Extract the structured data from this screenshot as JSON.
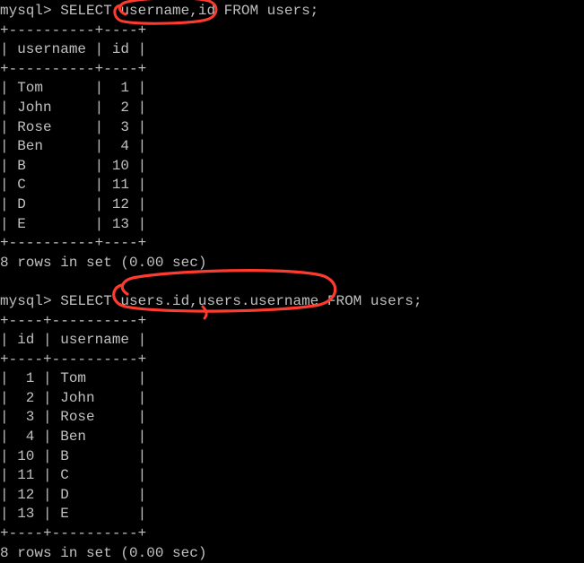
{
  "query1": {
    "prompt": "mysql> ",
    "sql": "SELECT username,id FROM users;",
    "columns": [
      "username",
      "id"
    ],
    "rows": [
      {
        "username": "Tom",
        "id": "1"
      },
      {
        "username": "John",
        "id": "2"
      },
      {
        "username": "Rose",
        "id": "3"
      },
      {
        "username": "Ben",
        "id": "4"
      },
      {
        "username": "B",
        "id": "10"
      },
      {
        "username": "C",
        "id": "11"
      },
      {
        "username": "D",
        "id": "12"
      },
      {
        "username": "E",
        "id": "13"
      }
    ],
    "result_msg": "8 rows in set (0.00 sec)"
  },
  "query2": {
    "prompt": "mysql> ",
    "sql": "SELECT users.id,users.username FROM users;",
    "columns": [
      "id",
      "username"
    ],
    "rows": [
      {
        "id": "1",
        "username": "Tom"
      },
      {
        "id": "2",
        "username": "John"
      },
      {
        "id": "3",
        "username": "Rose"
      },
      {
        "id": "4",
        "username": "Ben"
      },
      {
        "id": "10",
        "username": "B"
      },
      {
        "id": "11",
        "username": "C"
      },
      {
        "id": "12",
        "username": "D"
      },
      {
        "id": "13",
        "username": "E"
      }
    ],
    "result_msg": "8 rows in set (0.00 sec)"
  },
  "annotation_color": "#ff3b30"
}
